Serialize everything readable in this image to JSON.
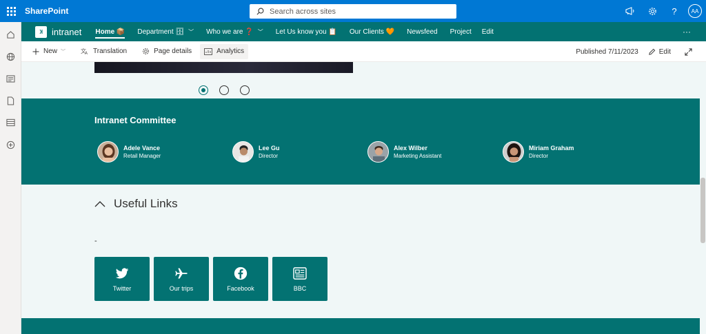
{
  "suite": {
    "brand": "SharePoint",
    "search_placeholder": "Search across sites",
    "user_initials": "AA"
  },
  "site": {
    "title": "intranet",
    "nav": [
      {
        "label": "Home 📦",
        "active": true
      },
      {
        "label": "Department 🗄",
        "chevron": true
      },
      {
        "label": "Who we are ❓",
        "chevron": true
      },
      {
        "label": "Let Us know you 📋"
      },
      {
        "label": "Our Clients 🧡"
      },
      {
        "label": "Newsfeed"
      },
      {
        "label": "Project"
      }
    ],
    "edit_label": "Edit",
    "more_label": "···"
  },
  "command_bar": {
    "new_label": "New",
    "translation_label": "Translation",
    "page_details_label": "Page details",
    "analytics_label": "Analytics",
    "published": "Published 7/11/2023",
    "edit_label": "Edit"
  },
  "carousel": {
    "slides": 3,
    "active_index": 0
  },
  "committee": {
    "title": "Intranet Committee",
    "people": [
      {
        "name": "Adele Vance",
        "role": "Retail Manager"
      },
      {
        "name": "Lee Gu",
        "role": "Director"
      },
      {
        "name": "Alex Wilber",
        "role": "Marketing Assistant"
      },
      {
        "name": "Miriam Graham",
        "role": "Director"
      }
    ]
  },
  "useful_links": {
    "title": "Useful Links",
    "description": "-",
    "tiles": [
      {
        "label": "Twitter",
        "icon": "twitter-icon"
      },
      {
        "label": "Our trips",
        "icon": "airplane-icon"
      },
      {
        "label": "Facebook",
        "icon": "facebook-icon"
      },
      {
        "label": "BBC",
        "icon": "news-icon"
      }
    ]
  },
  "colors": {
    "suite_blue": "#0078d4",
    "theme_teal": "#037272",
    "page_bg": "#f0f7f7"
  }
}
